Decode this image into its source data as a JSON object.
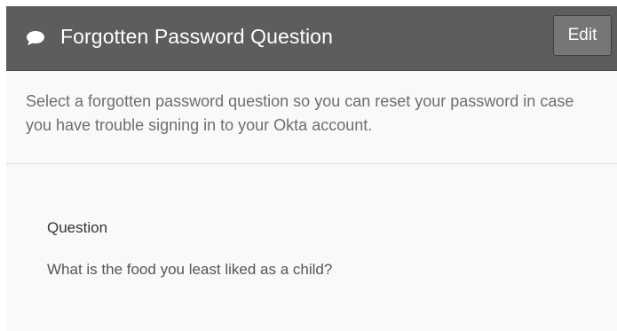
{
  "header": {
    "icon": "chat-bubble-icon",
    "title": "Forgotten Password Question",
    "edit_label": "Edit",
    "background_color": "#5d5d5d"
  },
  "description": "Select a forgotten password question so you can reset your password in case you have trouble signing in to your Okta account.",
  "question": {
    "label": "Question",
    "value": "What is the food you least liked as a child?"
  }
}
